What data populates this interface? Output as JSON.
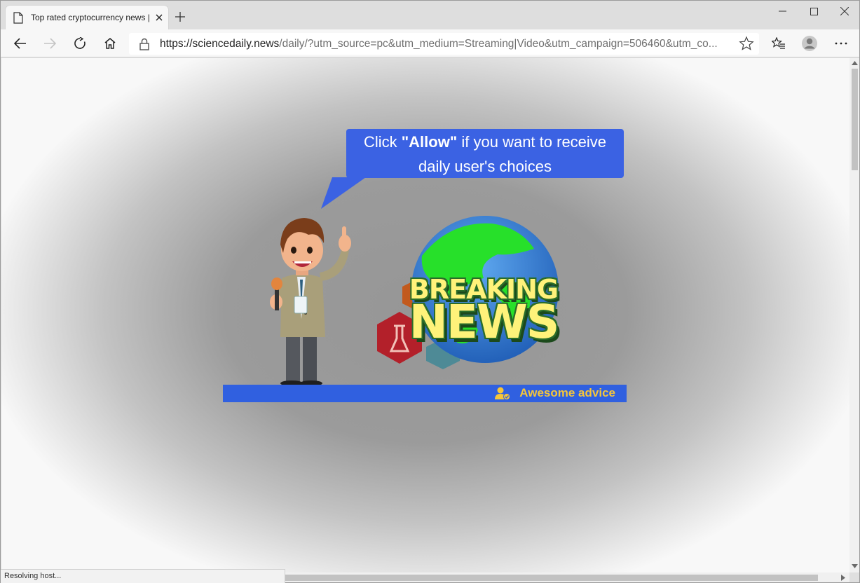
{
  "tab": {
    "title": "Top rated cryptocurrency news |"
  },
  "toolbar": {
    "url_host": "https://sciencedaily.news",
    "url_rest": "/daily/?utm_source=pc&utm_medium=Streaming|Video&utm_campaign=506460&utm_co..."
  },
  "page": {
    "bubble_pre": "Click ",
    "bubble_allow": "\"Allow\"",
    "bubble_post": " if you want to receive daily user's choices",
    "breaking": "BREAKING",
    "news": "NEWS",
    "banner_text": "Awesome advice"
  },
  "status": {
    "text": "Resolving host..."
  },
  "colors": {
    "bubble": "#3b62e3",
    "banner": "#3060e0",
    "banner_text": "#f6c63a",
    "headline": "#fff27a"
  }
}
